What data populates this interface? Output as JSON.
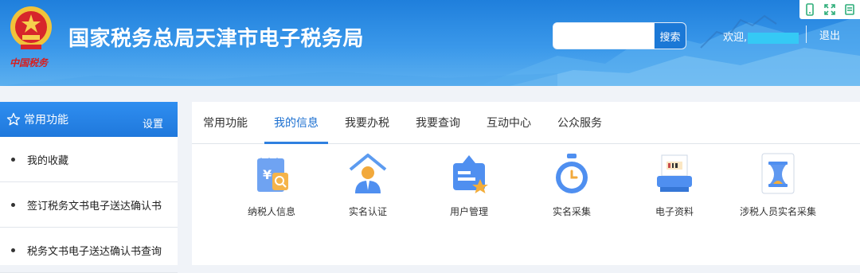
{
  "header": {
    "emblem_text": "中国税务",
    "title": "国家税务总局天津市电子税务局",
    "search": {
      "placeholder": "",
      "button_label": "搜索"
    },
    "welcome": "欢迎,",
    "logout": "退出",
    "tools": [
      "mobile-icon",
      "fullscreen-icon",
      "print-icon"
    ]
  },
  "sidebar": {
    "title": "常用功能",
    "settings": "设置",
    "items": [
      {
        "label": "我的收藏"
      },
      {
        "label": "签订税务文书电子送达确认书"
      },
      {
        "label": "税务文书电子送达确认书查询"
      }
    ]
  },
  "tabs": [
    {
      "label": "常用功能"
    },
    {
      "label": "我的信息",
      "active": true
    },
    {
      "label": "我要办税"
    },
    {
      "label": "我要查询"
    },
    {
      "label": "互动中心"
    },
    {
      "label": "公众服务"
    }
  ],
  "tiles": [
    {
      "label": "纳税人信息",
      "icon": "taxpayer-info-icon"
    },
    {
      "label": "实名认证",
      "icon": "real-name-auth-icon"
    },
    {
      "label": "用户管理",
      "icon": "user-management-icon"
    },
    {
      "label": "实名采集",
      "icon": "real-name-collect-icon"
    },
    {
      "label": "电子资料",
      "icon": "e-documents-icon"
    },
    {
      "label": "涉税人员实名采集",
      "icon": "tax-personnel-collect-icon"
    }
  ],
  "colors": {
    "header_blue": "#2a8ce6",
    "accent": "#2f80e0",
    "welcome_mask": "#35c9f5"
  }
}
